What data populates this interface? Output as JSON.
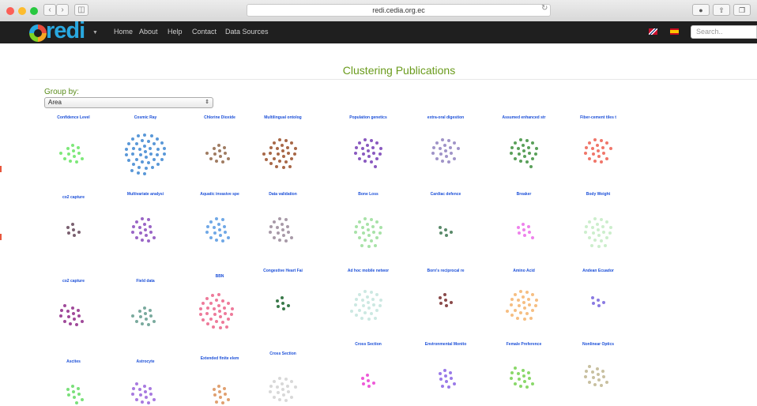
{
  "browser": {
    "url": "redi.cedia.org.ec",
    "back_icon": "chevron-left-icon",
    "forward_icon": "chevron-right-icon",
    "reload_icon": "reload-icon"
  },
  "navbar": {
    "logo_text": "redi",
    "menu": [
      "Home",
      "About",
      "Help",
      "Contact",
      "Data Sources"
    ],
    "search_placeholder": "Search.."
  },
  "page": {
    "title": "Clustering Publications",
    "group_by_label": "Group by:",
    "group_by_value": "Area"
  },
  "clusters": [
    {
      "title": "Confidence Level",
      "color": "#7ee87a",
      "count": 12
    },
    {
      "title": "Cosmic Ray",
      "color": "#5a98d8",
      "count": 40
    },
    {
      "title": "Chlorine Dioxide",
      "color": "#a07c62",
      "count": 12
    },
    {
      "title": "Multilingual ontolog",
      "color": "#a86848",
      "count": 25
    },
    {
      "title": "Population genetics",
      "color": "#8a5ac0",
      "count": 20
    },
    {
      "title": "extra-oral digestion",
      "color": "#a094c8",
      "count": 18
    },
    {
      "title": "Assumed enhanced str",
      "color": "#5aa05a",
      "count": 20
    },
    {
      "title": "Fiber-cement tiles t",
      "color": "#f0766a",
      "count": 18
    },
    {
      "title": "co2 capture",
      "color": "#7a6070",
      "count": 6
    },
    {
      "title": "Multivariate analysi",
      "color": "#9a66c6",
      "count": 16
    },
    {
      "title": "Aquatic invasive spe",
      "color": "#70a8e6",
      "count": 16
    },
    {
      "title": "Data validation",
      "color": "#a89aa8",
      "count": 16
    },
    {
      "title": "Bone Loss",
      "color": "#a8e2a8",
      "count": 22
    },
    {
      "title": "Cardiac defence",
      "color": "#5a8a6a",
      "count": 5
    },
    {
      "title": "Breaker",
      "color": "#ee82ec",
      "count": 8
    },
    {
      "title": "Body Weight",
      "color": "#cceecc",
      "count": 22
    },
    {
      "title": "co2 capture",
      "color": "#a04a9a",
      "count": 14
    },
    {
      "title": "Field data",
      "color": "#7aaa9e",
      "count": 12
    },
    {
      "title": "BBN",
      "color": "#ee7a9a",
      "count": 30
    },
    {
      "title": "Congestive Heart Fai",
      "color": "#3a7a4a",
      "count": 6
    },
    {
      "title": "Ad hoc mobile networ",
      "color": "#cce8e2",
      "count": 24
    },
    {
      "title": "Born's reciprocal re",
      "color": "#8a4a4a",
      "count": 6
    },
    {
      "title": "Amino Acid",
      "color": "#f6be82",
      "count": 24
    },
    {
      "title": "Andean Ecuador",
      "color": "#8a7ae2",
      "count": 5
    },
    {
      "title": "Ascites",
      "color": "#7ae07a",
      "count": 9
    },
    {
      "title": "Astrocyte",
      "color": "#a87ae0",
      "count": 14
    },
    {
      "title": "Extended finite elem",
      "color": "#e0a070",
      "count": 10
    },
    {
      "title": "Cross Section",
      "color": "#d8d8d8",
      "count": 18
    },
    {
      "title": "Cross Section",
      "color": "#ee5ad8",
      "count": 6
    },
    {
      "title": "Environmental Monito",
      "color": "#9a7ae8",
      "count": 10
    },
    {
      "title": "Female Preference",
      "color": "#8ad86a",
      "count": 14
    },
    {
      "title": "Nonlinear Optics",
      "color": "#c8c0a0",
      "count": 14
    }
  ]
}
